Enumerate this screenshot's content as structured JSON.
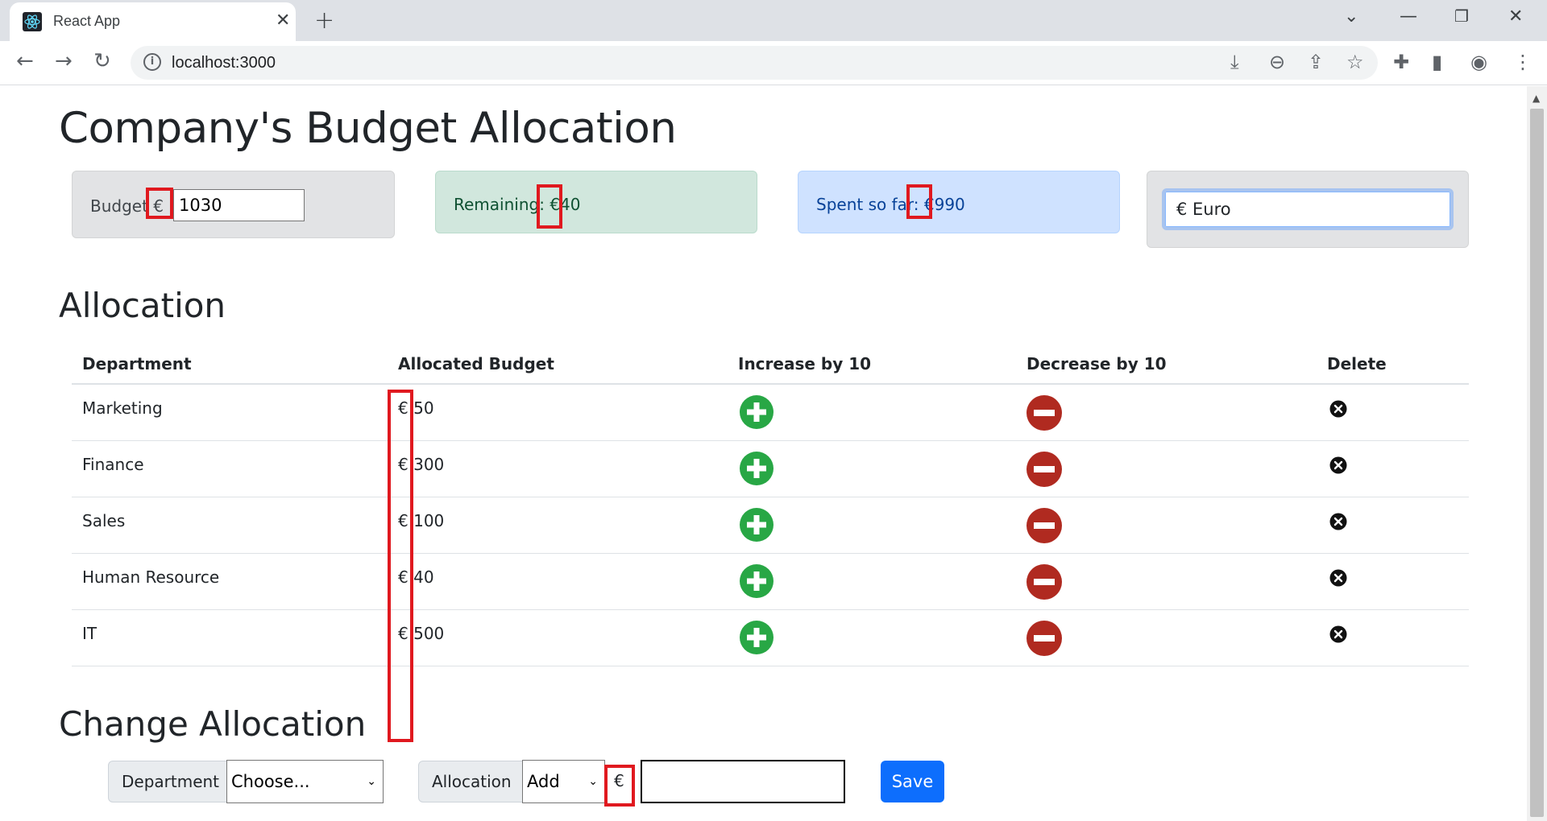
{
  "browser": {
    "tab_title": "React App",
    "url": "localhost:3000"
  },
  "page": {
    "title": "Company's Budget Allocation",
    "budget": {
      "label": "Budget",
      "currency": "€",
      "value": "1030"
    },
    "remaining": {
      "label": "Remaining:",
      "currency": "€",
      "value": "40"
    },
    "spent": {
      "label": "Spent so far:",
      "currency": "€",
      "value": "990"
    },
    "currency_select": {
      "value": "€ Euro"
    },
    "allocation_heading": "Allocation",
    "table": {
      "headers": [
        "Department",
        "Allocated Budget",
        "Increase by 10",
        "Decrease by 10",
        "Delete"
      ],
      "rows": [
        {
          "department": "Marketing",
          "currency": "€",
          "budget": "50"
        },
        {
          "department": "Finance",
          "currency": "€",
          "budget": "300"
        },
        {
          "department": "Sales",
          "currency": "€",
          "budget": "100"
        },
        {
          "department": "Human Resource",
          "currency": "€",
          "budget": "40"
        },
        {
          "department": "IT",
          "currency": "€",
          "budget": "500"
        }
      ]
    },
    "change_heading": "Change Allocation",
    "change": {
      "department_label": "Department",
      "department_value": "Choose...",
      "allocation_label": "Allocation",
      "allocation_value": "Add",
      "currency": "€",
      "amount": "",
      "save_label": "Save"
    }
  },
  "colors": {
    "increase": "#28a745",
    "decrease": "#b02a20",
    "highlight": "#e0191f",
    "save": "#0d6efd"
  }
}
